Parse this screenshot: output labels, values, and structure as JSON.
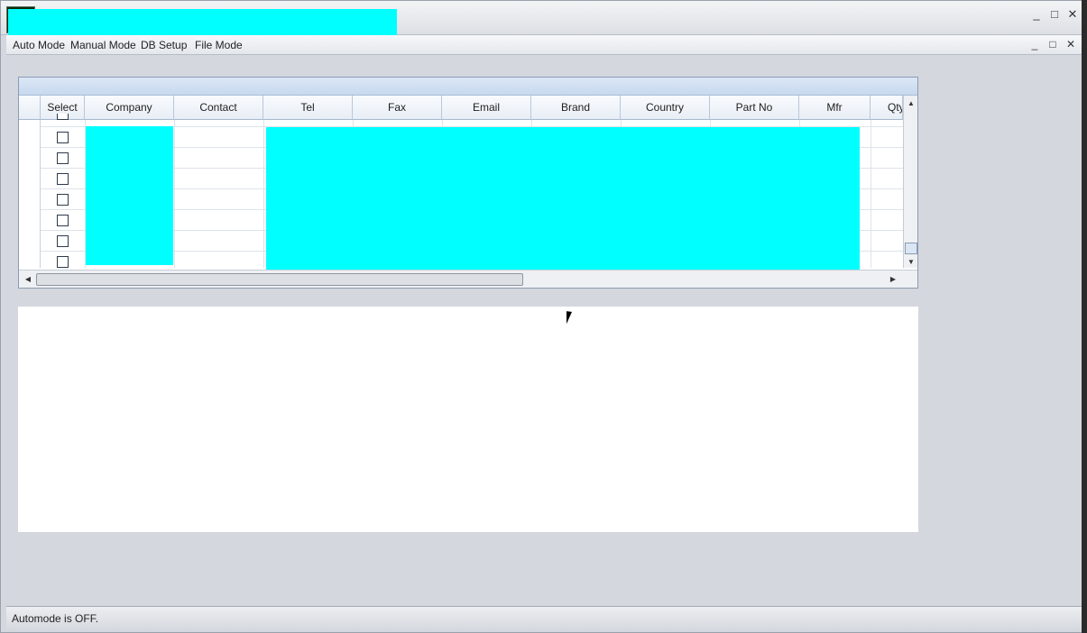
{
  "window": {
    "minimize": "_",
    "maximize": "□",
    "close": "✕"
  },
  "menu": {
    "items": [
      "Auto Mode",
      "Manual Mode",
      "DB Setup",
      "File Mode"
    ]
  },
  "grid": {
    "columns": [
      "Select",
      "Company",
      "Contact",
      "Tel",
      "Fax",
      "Email",
      "Brand",
      "Country",
      "Part No",
      "Mfr",
      "Qty"
    ],
    "row_count_visible": 7,
    "checkboxes_checked": [
      false,
      false,
      false,
      false,
      false,
      false,
      false
    ]
  },
  "status": {
    "text": "Automode is OFF."
  },
  "colors": {
    "redaction": "#00ffff",
    "background": "#d4d7de"
  },
  "icons": {
    "scroll_up": "up-arrow-icon",
    "scroll_down": "down-arrow-icon",
    "scroll_left": "left-arrow-icon",
    "scroll_right": "right-arrow-icon"
  }
}
